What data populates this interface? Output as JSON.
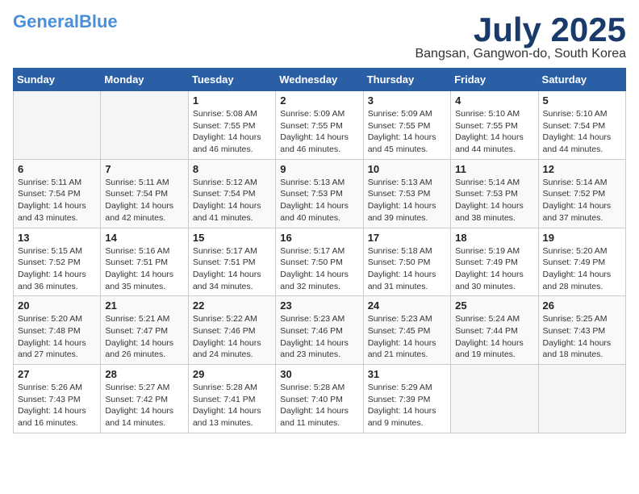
{
  "header": {
    "logo_line1": "General",
    "logo_line2": "Blue",
    "month": "July 2025",
    "location": "Bangsan, Gangwon-do, South Korea"
  },
  "weekdays": [
    "Sunday",
    "Monday",
    "Tuesday",
    "Wednesday",
    "Thursday",
    "Friday",
    "Saturday"
  ],
  "weeks": [
    [
      {
        "day": "",
        "info": ""
      },
      {
        "day": "",
        "info": ""
      },
      {
        "day": "1",
        "info": "Sunrise: 5:08 AM\nSunset: 7:55 PM\nDaylight: 14 hours and 46 minutes."
      },
      {
        "day": "2",
        "info": "Sunrise: 5:09 AM\nSunset: 7:55 PM\nDaylight: 14 hours and 46 minutes."
      },
      {
        "day": "3",
        "info": "Sunrise: 5:09 AM\nSunset: 7:55 PM\nDaylight: 14 hours and 45 minutes."
      },
      {
        "day": "4",
        "info": "Sunrise: 5:10 AM\nSunset: 7:55 PM\nDaylight: 14 hours and 44 minutes."
      },
      {
        "day": "5",
        "info": "Sunrise: 5:10 AM\nSunset: 7:54 PM\nDaylight: 14 hours and 44 minutes."
      }
    ],
    [
      {
        "day": "6",
        "info": "Sunrise: 5:11 AM\nSunset: 7:54 PM\nDaylight: 14 hours and 43 minutes."
      },
      {
        "day": "7",
        "info": "Sunrise: 5:11 AM\nSunset: 7:54 PM\nDaylight: 14 hours and 42 minutes."
      },
      {
        "day": "8",
        "info": "Sunrise: 5:12 AM\nSunset: 7:54 PM\nDaylight: 14 hours and 41 minutes."
      },
      {
        "day": "9",
        "info": "Sunrise: 5:13 AM\nSunset: 7:53 PM\nDaylight: 14 hours and 40 minutes."
      },
      {
        "day": "10",
        "info": "Sunrise: 5:13 AM\nSunset: 7:53 PM\nDaylight: 14 hours and 39 minutes."
      },
      {
        "day": "11",
        "info": "Sunrise: 5:14 AM\nSunset: 7:53 PM\nDaylight: 14 hours and 38 minutes."
      },
      {
        "day": "12",
        "info": "Sunrise: 5:14 AM\nSunset: 7:52 PM\nDaylight: 14 hours and 37 minutes."
      }
    ],
    [
      {
        "day": "13",
        "info": "Sunrise: 5:15 AM\nSunset: 7:52 PM\nDaylight: 14 hours and 36 minutes."
      },
      {
        "day": "14",
        "info": "Sunrise: 5:16 AM\nSunset: 7:51 PM\nDaylight: 14 hours and 35 minutes."
      },
      {
        "day": "15",
        "info": "Sunrise: 5:17 AM\nSunset: 7:51 PM\nDaylight: 14 hours and 34 minutes."
      },
      {
        "day": "16",
        "info": "Sunrise: 5:17 AM\nSunset: 7:50 PM\nDaylight: 14 hours and 32 minutes."
      },
      {
        "day": "17",
        "info": "Sunrise: 5:18 AM\nSunset: 7:50 PM\nDaylight: 14 hours and 31 minutes."
      },
      {
        "day": "18",
        "info": "Sunrise: 5:19 AM\nSunset: 7:49 PM\nDaylight: 14 hours and 30 minutes."
      },
      {
        "day": "19",
        "info": "Sunrise: 5:20 AM\nSunset: 7:49 PM\nDaylight: 14 hours and 28 minutes."
      }
    ],
    [
      {
        "day": "20",
        "info": "Sunrise: 5:20 AM\nSunset: 7:48 PM\nDaylight: 14 hours and 27 minutes."
      },
      {
        "day": "21",
        "info": "Sunrise: 5:21 AM\nSunset: 7:47 PM\nDaylight: 14 hours and 26 minutes."
      },
      {
        "day": "22",
        "info": "Sunrise: 5:22 AM\nSunset: 7:46 PM\nDaylight: 14 hours and 24 minutes."
      },
      {
        "day": "23",
        "info": "Sunrise: 5:23 AM\nSunset: 7:46 PM\nDaylight: 14 hours and 23 minutes."
      },
      {
        "day": "24",
        "info": "Sunrise: 5:23 AM\nSunset: 7:45 PM\nDaylight: 14 hours and 21 minutes."
      },
      {
        "day": "25",
        "info": "Sunrise: 5:24 AM\nSunset: 7:44 PM\nDaylight: 14 hours and 19 minutes."
      },
      {
        "day": "26",
        "info": "Sunrise: 5:25 AM\nSunset: 7:43 PM\nDaylight: 14 hours and 18 minutes."
      }
    ],
    [
      {
        "day": "27",
        "info": "Sunrise: 5:26 AM\nSunset: 7:43 PM\nDaylight: 14 hours and 16 minutes."
      },
      {
        "day": "28",
        "info": "Sunrise: 5:27 AM\nSunset: 7:42 PM\nDaylight: 14 hours and 14 minutes."
      },
      {
        "day": "29",
        "info": "Sunrise: 5:28 AM\nSunset: 7:41 PM\nDaylight: 14 hours and 13 minutes."
      },
      {
        "day": "30",
        "info": "Sunrise: 5:28 AM\nSunset: 7:40 PM\nDaylight: 14 hours and 11 minutes."
      },
      {
        "day": "31",
        "info": "Sunrise: 5:29 AM\nSunset: 7:39 PM\nDaylight: 14 hours and 9 minutes."
      },
      {
        "day": "",
        "info": ""
      },
      {
        "day": "",
        "info": ""
      }
    ]
  ]
}
